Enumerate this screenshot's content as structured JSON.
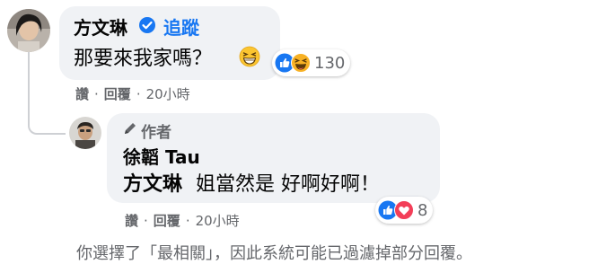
{
  "comment1": {
    "author": "方文琳",
    "follow_label": "追蹤",
    "text": "那要來我家嗎？",
    "emoji": "grinning-squinting-emoji",
    "reaction_count": "130",
    "actions": {
      "like": "讚",
      "reply": "回覆",
      "time": "20小時"
    }
  },
  "reply1": {
    "author_badge": "作者",
    "author": "徐韜 Tau",
    "mention": "方文琳",
    "text": "姐當然是 好啊好啊！",
    "reaction_count": "8",
    "actions": {
      "like": "讚",
      "reply": "回覆",
      "time": "20小時"
    }
  },
  "footer": {
    "filter_note": "你選擇了「最相關」，因此系統可能已過濾掉部分回覆。"
  },
  "colors": {
    "accent": "#1877f2",
    "bubble": "#f0f2f5",
    "secondary_text": "#65676b",
    "love": "#f33e58",
    "haha": "#f7b125"
  }
}
